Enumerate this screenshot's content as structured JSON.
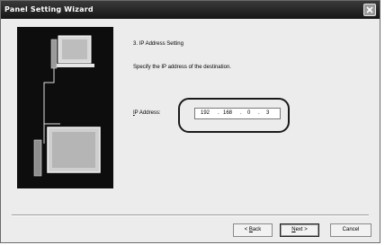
{
  "window": {
    "title": "Panel Setting Wizard"
  },
  "step": {
    "title": "3. IP Address Setting",
    "instruction": "Specify the IP address of the destination."
  },
  "ip": {
    "label_mnemonic": "I",
    "label_rest": "P Address:",
    "octets": [
      "192",
      "168",
      "0",
      "3"
    ],
    "separators": [
      ".",
      ".",
      "."
    ]
  },
  "buttons": {
    "back_prefix": "< ",
    "back_mnemonic": "B",
    "back_rest": "ack",
    "next_mnemonic": "N",
    "next_rest": "ext >",
    "cancel": "Cancel"
  }
}
